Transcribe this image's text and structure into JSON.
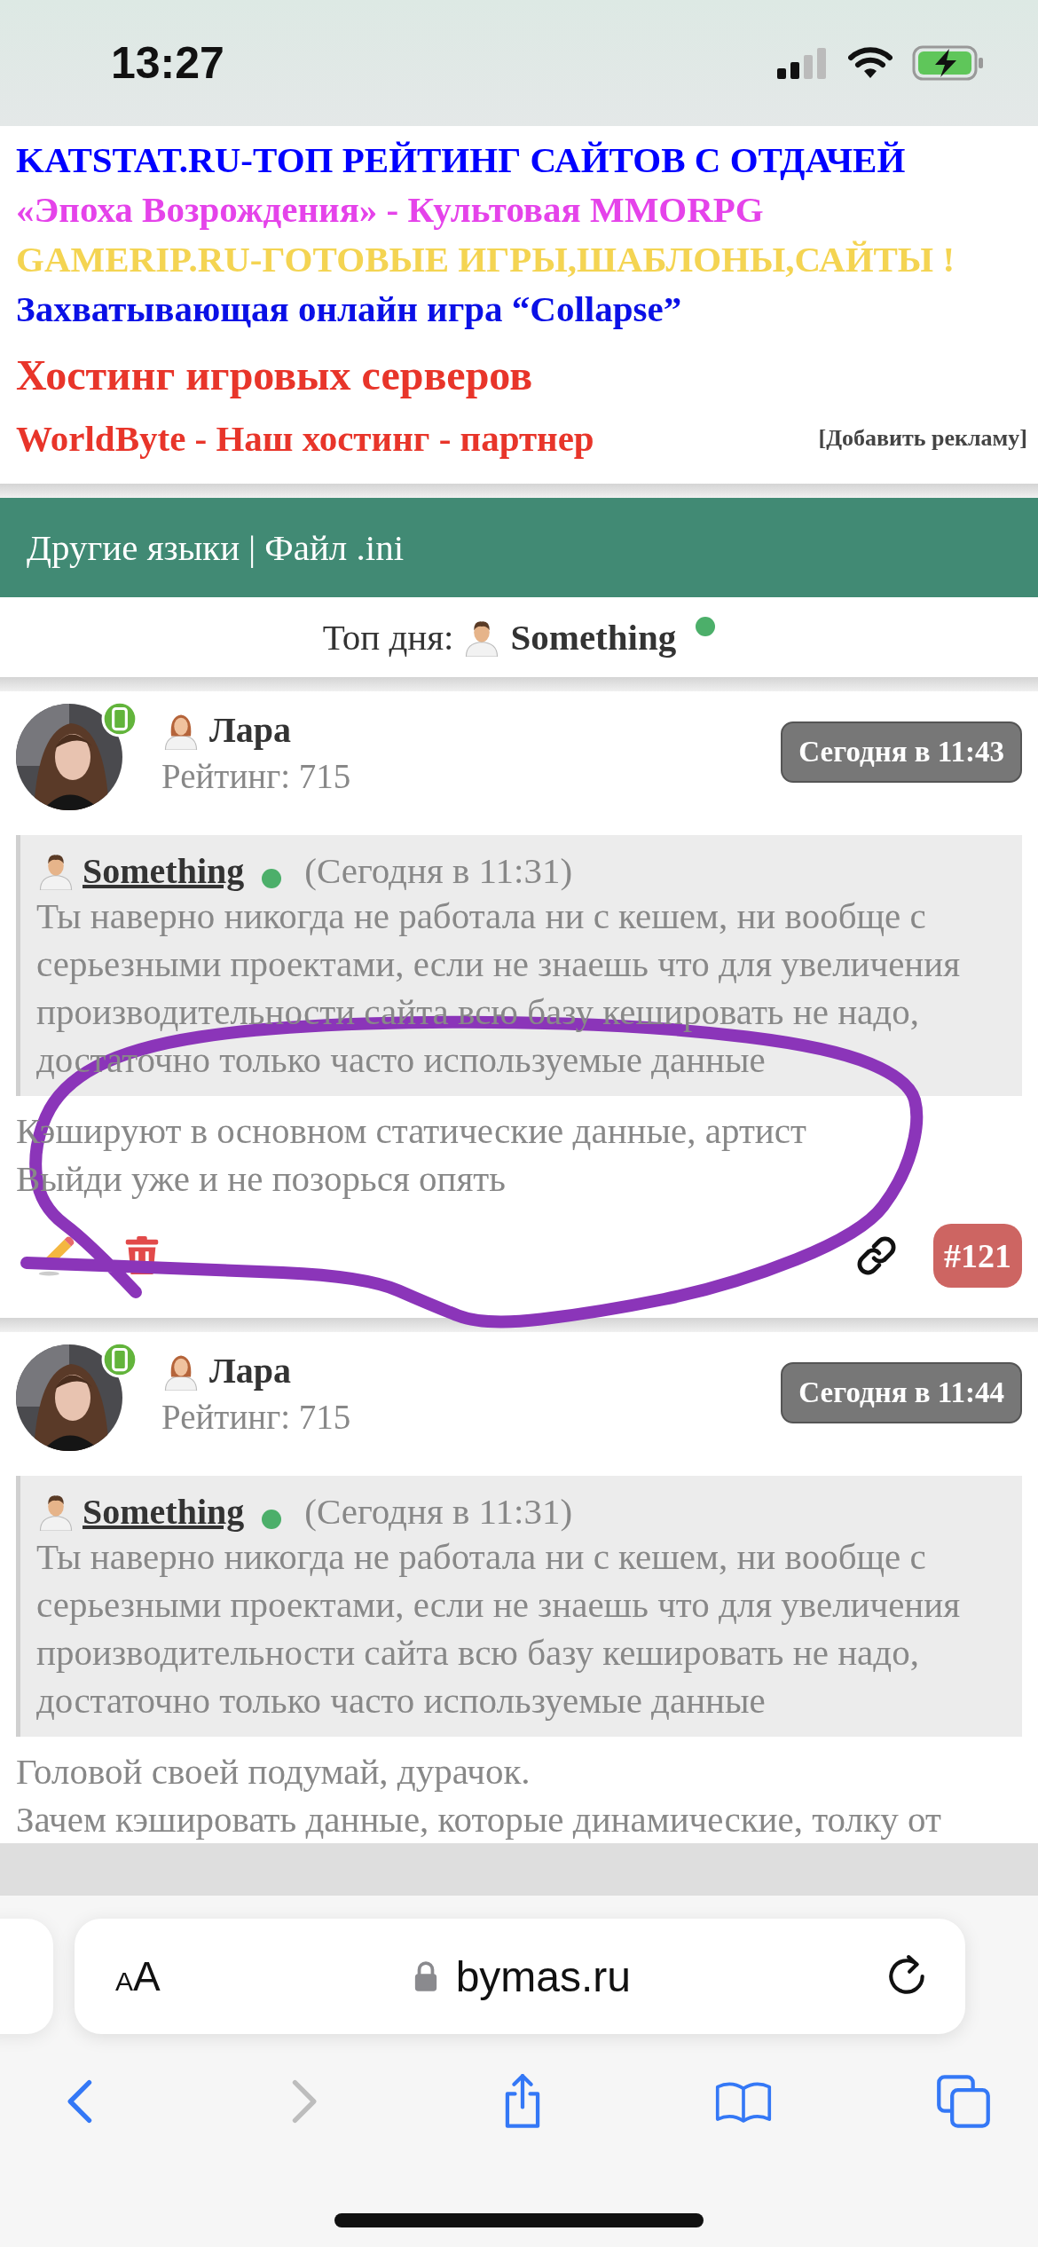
{
  "status_bar": {
    "time": "13:27"
  },
  "ads": {
    "lines": [
      {
        "text": "KATSTAT.RU-ТОП РЕЙТИНГ САЙТОВ С ОТДАЧЕЙ",
        "color": "#0000ff",
        "kind": "link"
      },
      {
        "text": "«Эпоха Возрождения» - Культовая MMORPG",
        "color": "#e543ea",
        "kind": "link"
      },
      {
        "text": "GAMERIP.RU-ГОТОВЫЕ ИГРЫ,ШАБЛОНЫ,САЙТЫ !",
        "color": "#f4d452",
        "kind": "link"
      },
      {
        "text": "Захватывающая онлайн игра “Collapse”",
        "color": "#0a10e6",
        "kind": "link"
      },
      {
        "text": "Хостинг игровых серверов",
        "color": "#e8352a",
        "kind": "headline"
      },
      {
        "text": "WorldByte - Наш хостинг - партнер",
        "color": "#e8352a",
        "kind": "link"
      }
    ],
    "add_ad": "[Добавить рекламу]"
  },
  "nav": {
    "links": [
      "Другие языки",
      "Файл .ini"
    ],
    "separator": "|"
  },
  "top_day": {
    "label": "Топ дня:",
    "user": "Something",
    "online": true
  },
  "posts": [
    {
      "author": "Лара",
      "mobile_online": true,
      "rating": "Рейтинг: 715",
      "time": "Сегодня в 11:43",
      "quote": {
        "author": "Something",
        "online": true,
        "time": "(Сегодня в 11:31)",
        "text": "Ты наверно никогда не работала ни с кешем, ни вообще с серьезными проектами, если не знаешь что для увеличения производительности сайта всю базу кешировать не надо, достаточно только часто используемые данные"
      },
      "lines": [
        "Кэшируют в основном статические данные, артист",
        "Выйди уже и не позорься опять"
      ],
      "number": "#121"
    },
    {
      "author": "Лара",
      "mobile_online": true,
      "rating": "Рейтинг: 715",
      "time": "Сегодня в 11:44",
      "quote": {
        "author": "Something",
        "online": true,
        "time": "(Сегодня в 11:31)",
        "text": "Ты наверно никогда не работала ни с кешем, ни вообще с серьезными проектами, если не знаешь что для увеличения производительности сайта всю базу кешировать не надо, достаточно только часто используемые данные"
      },
      "lines": [
        "Головой своей подумай, дурачок.",
        "Зачем кэшировать данные, которые динамические, толку от"
      ]
    }
  ],
  "browser": {
    "text_size": "AA",
    "address": "bymas.ru",
    "secure": true,
    "toolbar": [
      {
        "kind": "back",
        "disabled": false
      },
      {
        "kind": "forward",
        "disabled": true
      },
      {
        "kind": "share",
        "disabled": false
      },
      {
        "kind": "bookmarks",
        "disabled": false
      },
      {
        "kind": "tabs",
        "disabled": false
      }
    ]
  }
}
